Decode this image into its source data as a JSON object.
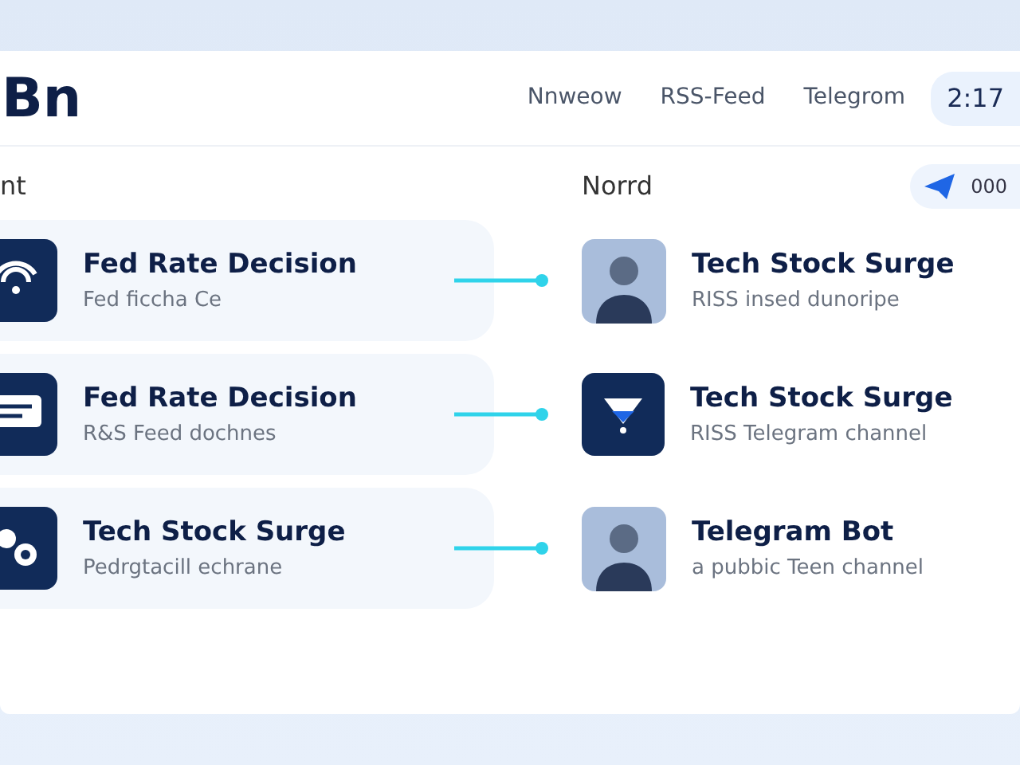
{
  "header": {
    "logo": "Bn",
    "nav": [
      {
        "label": "Nnweow"
      },
      {
        "label": "RSS-Feed"
      },
      {
        "label": "Telegrom"
      }
    ],
    "time": "2:17"
  },
  "subheader": {
    "left_label": "nt",
    "center_label": "Norrd",
    "badge": "000"
  },
  "sources": [
    {
      "title": "Fed Rate Decision",
      "subtitle": "Fed ficcha Ce",
      "kind": "wifi"
    },
    {
      "title": "Fed Rate Decision",
      "subtitle": "R&S Feed dochnes",
      "kind": "message"
    },
    {
      "title": "Tech Stock Surge",
      "subtitle": "Pedrgtacill echrane",
      "kind": "people"
    }
  ],
  "targets": [
    {
      "title": "Tech Stock Surge",
      "subtitle": "RISS insed dunoripe",
      "kind": "photo"
    },
    {
      "title": "Tech Stock Surge",
      "subtitle": "RISS Telegram channel",
      "kind": "funnel"
    },
    {
      "title": "Telegram Bot",
      "subtitle": "a pubbic Teen channel",
      "kind": "photo"
    }
  ]
}
